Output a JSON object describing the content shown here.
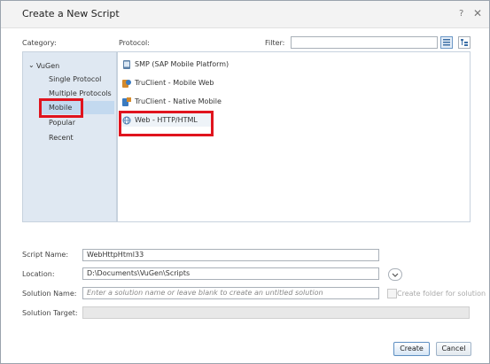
{
  "dialog": {
    "title": "Create a New Script"
  },
  "labels": {
    "category": "Category:",
    "protocol": "Protocol:",
    "filter": "Filter:"
  },
  "category_tree": {
    "root": "VuGen",
    "items": [
      "Single Protocol",
      "Multiple Protocols",
      "Mobile",
      "Popular",
      "Recent"
    ],
    "selected": "Mobile"
  },
  "protocols": [
    {
      "label": "SMP (SAP Mobile Platform)",
      "icon": "sap-icon"
    },
    {
      "label": "TruClient - Mobile Web",
      "icon": "truclient-icon"
    },
    {
      "label": "TruClient - Native Mobile",
      "icon": "truclient-native-icon"
    },
    {
      "label": "Web - HTTP/HTML",
      "icon": "web-globe-icon"
    }
  ],
  "selected_protocol": "Web - HTTP/HTML",
  "form": {
    "script_name_label": "Script Name:",
    "script_name_value": "WebHttpHtml33",
    "location_label": "Location:",
    "location_value": "D:\\Documents\\VuGen\\Scripts",
    "solution_name_label": "Solution Name:",
    "solution_name_placeholder": "Enter a solution name or leave blank to create an untitled solution",
    "create_folder_label": "Create folder for solution",
    "solution_target_label": "Solution Target:"
  },
  "buttons": {
    "create": "Create",
    "cancel": "Cancel"
  },
  "colors": {
    "highlight": "#e0141e",
    "category_bg": "#dfe8f2",
    "selection": "#c3d9ef"
  }
}
